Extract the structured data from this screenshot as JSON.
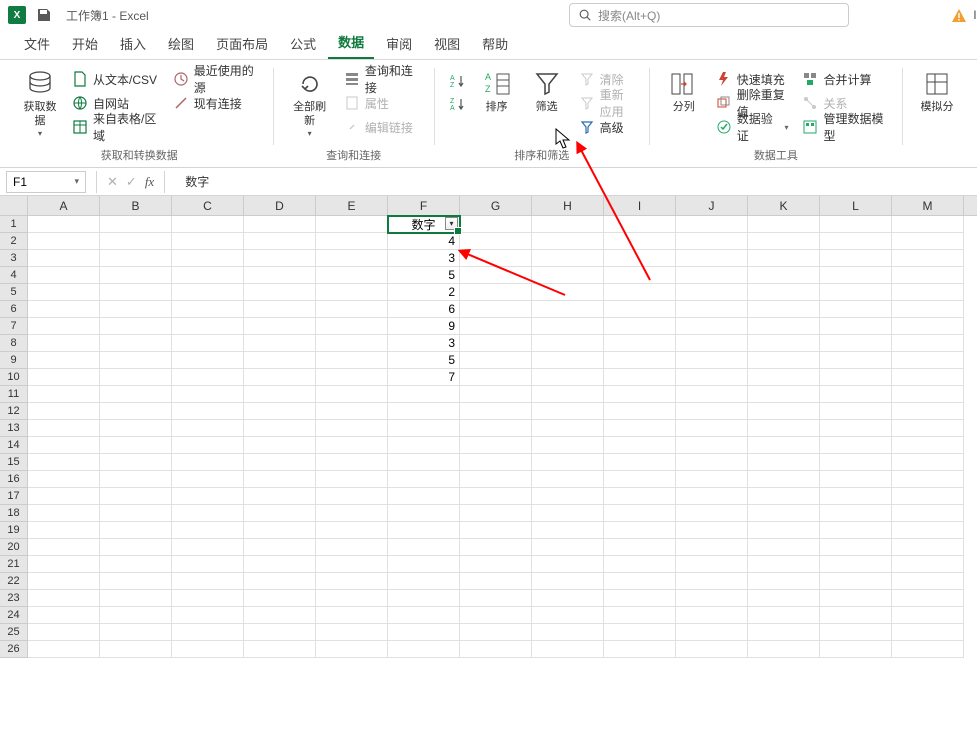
{
  "title": "工作簿1  -  Excel",
  "search_placeholder": "搜索(Alt+Q)",
  "warn_user": "li",
  "tabs": [
    "文件",
    "开始",
    "插入",
    "绘图",
    "页面布局",
    "公式",
    "数据",
    "审阅",
    "视图",
    "帮助"
  ],
  "active_tab": "数据",
  "ribbon": {
    "g1": {
      "label": "获取和转换数据",
      "big": "获取数\n据",
      "s1": "从文本/CSV",
      "s2": "自网站",
      "s3": "来自表格/区域",
      "s4": "最近使用的源",
      "s5": "现有连接"
    },
    "g2": {
      "label": "查询和连接",
      "big": "全部刷新",
      "s1": "查询和连接",
      "s2": "属性",
      "s3": "编辑链接"
    },
    "g3": {
      "label": "排序和筛选",
      "sort": "排序",
      "filter": "筛选",
      "s1": "清除",
      "s2": "重新应用",
      "s3": "高级"
    },
    "g4": {
      "label": "数据工具",
      "big": "分列",
      "s1": "快速填充",
      "s2": "删除重复值",
      "s3": "数据验证",
      "s4": "合并计算",
      "s5": "关系",
      "s6": "管理数据模型"
    },
    "g5": {
      "big": "模拟分"
    }
  },
  "name_box": "F1",
  "formula": "数字",
  "columns": [
    "A",
    "B",
    "C",
    "D",
    "E",
    "F",
    "G",
    "H",
    "I",
    "J",
    "K",
    "L",
    "M"
  ],
  "row_count": 26,
  "chart_data": {
    "type": "table",
    "active_cell": "F1",
    "header": {
      "cell": "F1",
      "label": "数字",
      "has_filter": true
    },
    "values_column": "F",
    "rows": [
      {
        "row": 2,
        "value": 4
      },
      {
        "row": 3,
        "value": 3
      },
      {
        "row": 4,
        "value": 5
      },
      {
        "row": 5,
        "value": 2
      },
      {
        "row": 6,
        "value": 6
      },
      {
        "row": 7,
        "value": 9
      },
      {
        "row": 8,
        "value": 3
      },
      {
        "row": 9,
        "value": 5
      },
      {
        "row": 10,
        "value": 7
      }
    ]
  }
}
